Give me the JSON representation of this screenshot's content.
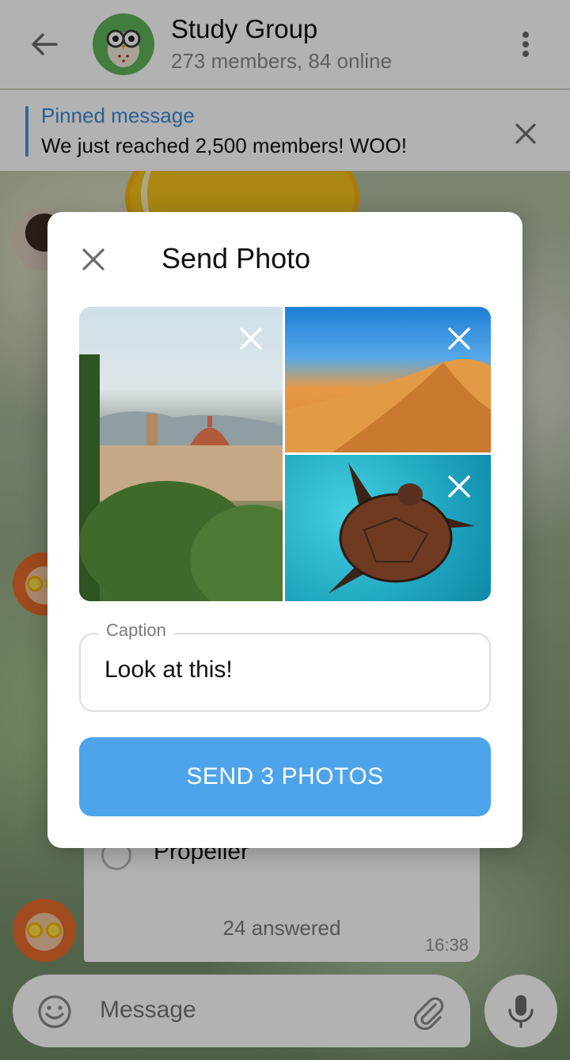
{
  "header": {
    "title": "Study Group",
    "subtitle": "273 members, 84 online",
    "back_icon": "arrow-left-icon",
    "menu_icon": "more-vertical-icon"
  },
  "pinned": {
    "title": "Pinned message",
    "text": "We just reached 2,500 members! WOO!",
    "close_icon": "close-icon"
  },
  "chat": {
    "poll_option": "Propeller",
    "poll_answered": "24 answered",
    "poll_time": "16:38"
  },
  "composer": {
    "placeholder": "Message",
    "emoji_icon": "emoji-icon",
    "attach_icon": "paperclip-icon",
    "mic_icon": "microphone-icon"
  },
  "dialog": {
    "title": "Send Photo",
    "close_icon": "close-icon",
    "photos": [
      "florence-photo",
      "desert-photo",
      "sea-turtle-photo"
    ],
    "caption_label": "Caption",
    "caption_value": "Look at this!",
    "send_label": "SEND 3 PHOTOS"
  },
  "colors": {
    "accent": "#4ea4ea",
    "pinned_accent": "#3c8ad6"
  }
}
